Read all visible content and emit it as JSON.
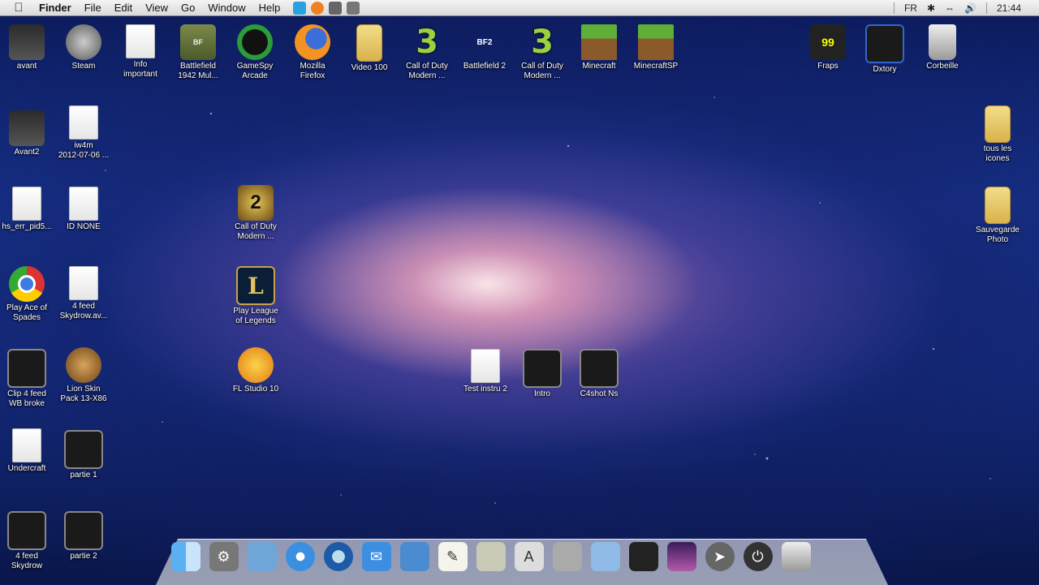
{
  "menubar": {
    "app": "Finder",
    "items": [
      "File",
      "Edit",
      "View",
      "Go",
      "Window",
      "Help"
    ],
    "input_language": "FR",
    "clock": "21:44"
  },
  "desktop": {
    "icons": [
      {
        "label": "avant",
        "icon": "avatar-icon"
      },
      {
        "label": "Steam",
        "icon": "steam-icon"
      },
      {
        "label": "Info\nimportant",
        "icon": "document-icon"
      },
      {
        "label": "Battlefield\n1942 Mul...",
        "icon": "battlefield-1942-icon"
      },
      {
        "label": "GameSpy\nArcade",
        "icon": "gamespy-icon"
      },
      {
        "label": "Mozilla\nFirefox",
        "icon": "firefox-icon"
      },
      {
        "label": "Video 100",
        "icon": "folder-icon"
      },
      {
        "label": "Call of Duty\nModern ...",
        "icon": "cod-mw3-icon"
      },
      {
        "label": "Battlefield 2",
        "icon": "battlefield-2-icon"
      },
      {
        "label": "Call of Duty\nModern ...",
        "icon": "cod-mw3-icon"
      },
      {
        "label": "Minecraft",
        "icon": "minecraft-icon"
      },
      {
        "label": "MinecraftSP",
        "icon": "minecraft-icon"
      },
      {
        "label": "Fraps",
        "icon": "fraps-icon"
      },
      {
        "label": "Dxtory",
        "icon": "dxtory-icon"
      },
      {
        "label": "Corbeille",
        "icon": "trash-icon"
      },
      {
        "label": "Avant2",
        "icon": "avatar-icon"
      },
      {
        "label": "iw4m\n2012-07-06 ...",
        "icon": "document-icon"
      },
      {
        "label": "tous les\nicones",
        "icon": "folder-icon"
      },
      {
        "label": "hs_err_pid5...",
        "icon": "document-icon"
      },
      {
        "label": "ID NONE",
        "icon": "document-icon"
      },
      {
        "label": "Call of Duty\nModern ...",
        "icon": "cod-mw2-icon"
      },
      {
        "label": "Sauvegarde\nPhoto",
        "icon": "folder-icon"
      },
      {
        "label": "Play Ace of\nSpades",
        "icon": "chrome-icon"
      },
      {
        "label": "4 feed\nSkydrow.av...",
        "icon": "document-icon"
      },
      {
        "label": "Play League\nof Legends",
        "icon": "league-of-legends-icon"
      },
      {
        "label": "Clip 4 feed\nWB broke",
        "icon": "video-icon"
      },
      {
        "label": "Lion Skin\nPack 13-X86",
        "icon": "lion-icon"
      },
      {
        "label": "FL Studio 10",
        "icon": "fl-studio-icon"
      },
      {
        "label": "Test instru 2",
        "icon": "mp3-icon"
      },
      {
        "label": "Intro",
        "icon": "video-icon"
      },
      {
        "label": "C4shot Ns",
        "icon": "video-icon"
      },
      {
        "label": "Undercraft",
        "icon": "document-icon"
      },
      {
        "label": "partie 1",
        "icon": "video-icon"
      },
      {
        "label": "4 feed\nSkydrow",
        "icon": "video-icon"
      },
      {
        "label": "partie 2",
        "icon": "video-icon"
      }
    ],
    "fraps_badge": "99"
  },
  "dock": {
    "items": [
      "finder-icon",
      "system-preferences-icon",
      "applications-folder-icon",
      "safari-icon",
      "quicktime-icon",
      "mail-icon",
      "iphoto-icon",
      "textedit-icon",
      "calculator-icon",
      "app-store-icon",
      "disk-utility-icon",
      "documents-folder-icon",
      "qr-code-icon",
      "photo-booth-icon",
      "launchpad-icon",
      "shutdown-icon",
      "trash-icon"
    ]
  },
  "colors": {
    "menubar": "#e8e8e8",
    "label": "#ffffff",
    "accent": "#3b7de0"
  }
}
